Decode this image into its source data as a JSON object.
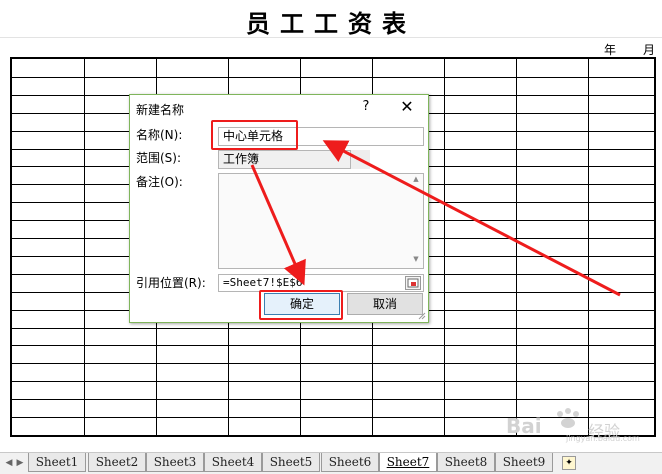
{
  "sheet": {
    "title": "员工工资表",
    "year_label": "年",
    "month_label": "月"
  },
  "dialog": {
    "title": "新建名称",
    "help": "?",
    "close": "✕",
    "name_label": "名称(N):",
    "name_value": "中心单元格",
    "scope_label": "范围(S):",
    "scope_value": "工作簿",
    "comment_label": "备注(O):",
    "comment_value": "",
    "refers_label": "引用位置(R):",
    "refers_value": "=Sheet7!$E$6",
    "ok_label": "确定",
    "cancel_label": "取消"
  },
  "tabs": [
    {
      "label": "Sheet1"
    },
    {
      "label": "Sheet2"
    },
    {
      "label": "Sheet3"
    },
    {
      "label": "Sheet4"
    },
    {
      "label": "Sheet5"
    },
    {
      "label": "Sheet6"
    },
    {
      "label": "Sheet7",
      "active": true
    },
    {
      "label": "Sheet8"
    },
    {
      "label": "Sheet9"
    }
  ],
  "watermark": {
    "logo": "Bai",
    "site": "经验",
    "url": "jingyan.baidu.com"
  },
  "colors": {
    "annotation_red": "#ee1c1c",
    "dialog_border": "#7fb55b",
    "default_button_border": "#3c7fb1"
  },
  "icons": {
    "range_picker": "collapse-dialog-icon",
    "add_sheet": "new-sheet-icon",
    "close": "close-icon"
  }
}
